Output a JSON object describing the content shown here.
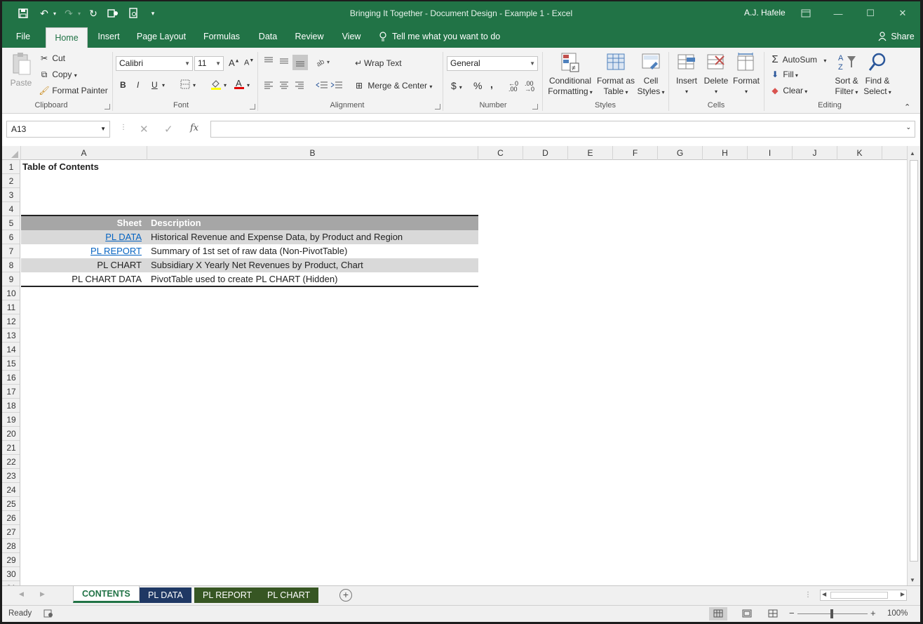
{
  "title_bar": {
    "document_title": "Bringing It Together - Document Design - Example 1  -  Excel",
    "user": "A.J. Hafele"
  },
  "tabs": [
    {
      "label": "File"
    },
    {
      "label": "Home"
    },
    {
      "label": "Insert"
    },
    {
      "label": "Page Layout"
    },
    {
      "label": "Formulas"
    },
    {
      "label": "Data"
    },
    {
      "label": "Review"
    },
    {
      "label": "View"
    }
  ],
  "tell_me": "Tell me what you want to do",
  "share": "Share",
  "ribbon": {
    "clipboard": {
      "paste": "Paste",
      "cut": "Cut",
      "copy": "Copy",
      "format_painter": "Format Painter",
      "label": "Clipboard"
    },
    "font": {
      "name": "Calibri",
      "size": "11",
      "label": "Font",
      "bold": "B",
      "italic": "I",
      "underline": "U"
    },
    "alignment": {
      "wrap_text": "Wrap Text",
      "merge_center": "Merge & Center",
      "label": "Alignment"
    },
    "number": {
      "format": "General",
      "label": "Number"
    },
    "styles": {
      "conditional_1": "Conditional",
      "conditional_2": "Formatting",
      "format_as_1": "Format as",
      "format_as_2": "Table",
      "cell_1": "Cell",
      "cell_2": "Styles",
      "label": "Styles"
    },
    "cells": {
      "insert": "Insert",
      "delete": "Delete",
      "format": "Format",
      "label": "Cells"
    },
    "editing": {
      "autosum": "AutoSum",
      "fill": "Fill",
      "clear": "Clear",
      "sort_1": "Sort &",
      "sort_2": "Filter",
      "find_1": "Find &",
      "find_2": "Select",
      "label": "Editing"
    }
  },
  "formula_bar": {
    "name_box": "A13",
    "formula": ""
  },
  "columns": [
    "A",
    "B",
    "C",
    "D",
    "E",
    "F",
    "G",
    "H",
    "I",
    "J",
    "K"
  ],
  "rows": [
    "1",
    "2",
    "3",
    "4",
    "5",
    "6",
    "7",
    "8",
    "9",
    "10",
    "11",
    "12",
    "13",
    "14",
    "15",
    "16",
    "17",
    "18",
    "19",
    "20",
    "21",
    "22",
    "23",
    "24",
    "25",
    "26",
    "27",
    "28",
    "29",
    "30",
    "31"
  ],
  "sheet": {
    "heading": "Table of Contents",
    "table_header": {
      "sheet": "Sheet",
      "description": "Description"
    },
    "table_rows": [
      {
        "sheet": "PL DATA",
        "description": "Historical Revenue and Expense Data, by Product and Region"
      },
      {
        "sheet": "PL REPORT",
        "description": "Summary of 1st set of raw data (Non-PivotTable)"
      },
      {
        "sheet": "PL CHART",
        "description": "Subsidiary X Yearly Net Revenues by Product, Chart"
      },
      {
        "sheet": "PL CHART DATA",
        "description": "PivotTable used to create PL CHART (Hidden)"
      }
    ]
  },
  "sheet_tabs": [
    {
      "label": "CONTENTS",
      "color": "#f0f0f0"
    },
    {
      "label": "PL DATA",
      "color": "#1f3864"
    },
    {
      "label": "PL REPORT",
      "color": "#375623"
    },
    {
      "label": "PL CHART",
      "color": "#375623"
    }
  ],
  "status": {
    "ready": "Ready",
    "zoom": "100%"
  },
  "colors": {
    "excel_green": "#217346",
    "link": "#0563c1",
    "header_gray": "#a6a6a6",
    "band_gray": "#d9d9d9"
  }
}
